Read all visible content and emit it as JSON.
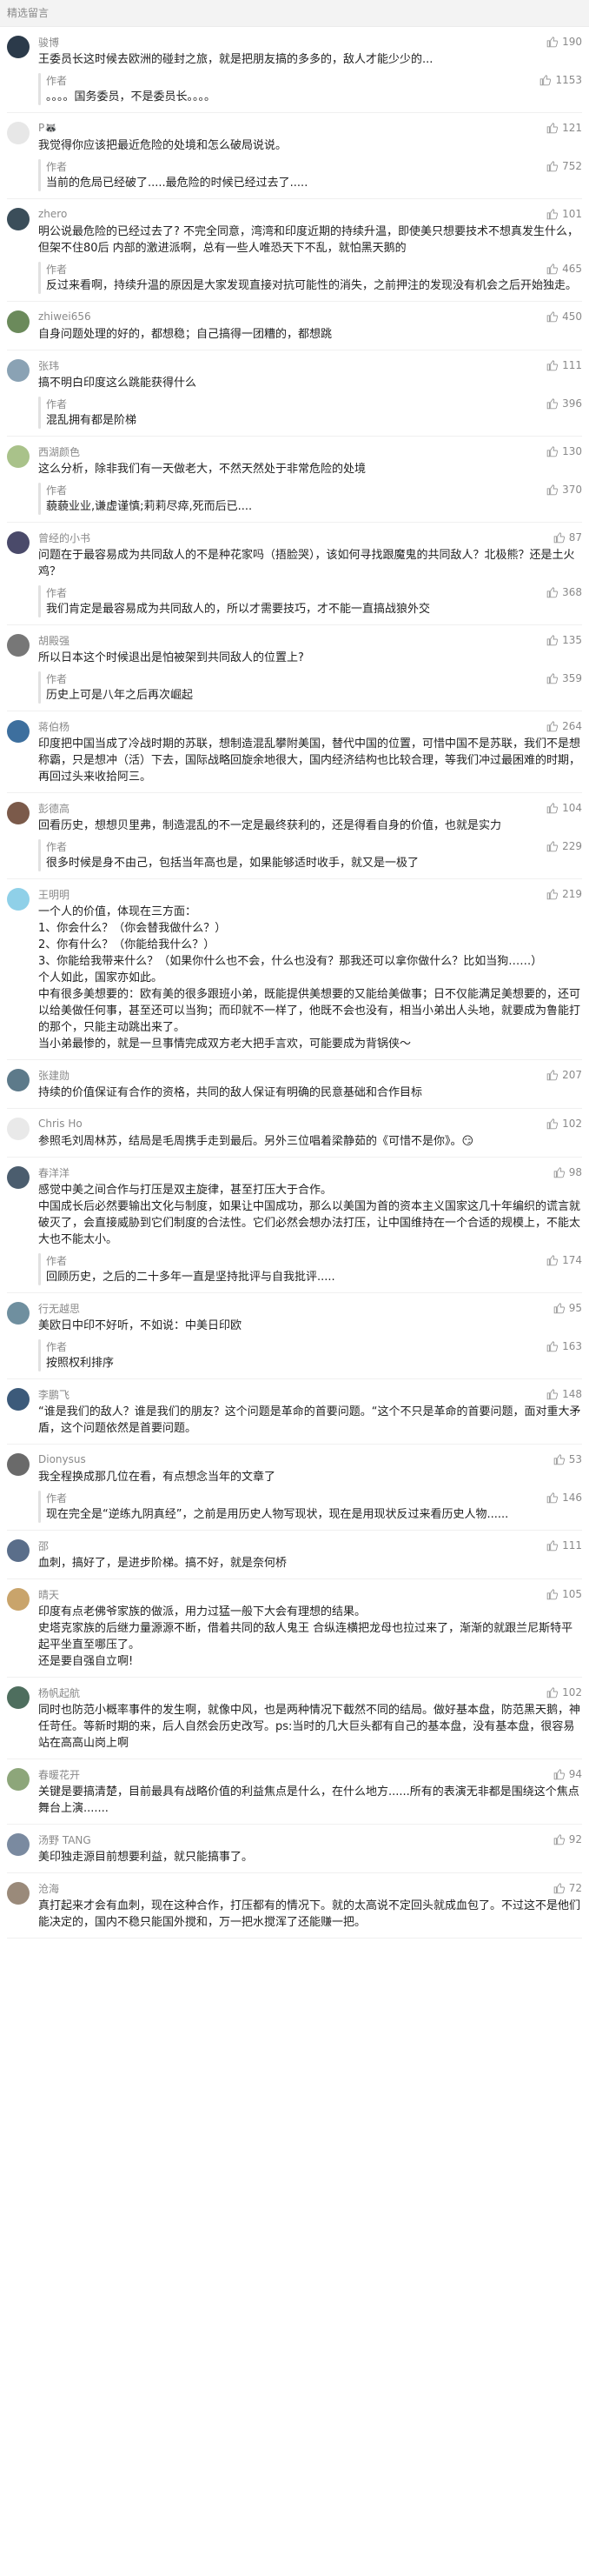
{
  "header": {
    "title": "精选留言"
  },
  "comments": [
    {
      "name": "骏博",
      "likes": "190",
      "avatar_color": "#2b3a4a",
      "text": "王委员长这时候去欧洲的碰封之旅，就是把朋友搞的多多的，敌人才能少少的...",
      "reply_name": "作者",
      "reply_likes": "1153",
      "reply_text": "。。。。国务委员，不是委员长。。。。"
    },
    {
      "name": "P🦝",
      "likes": "121",
      "avatar_color": "#e7e7e7",
      "text": "我觉得你应该把最近危险的处境和怎么破局说说。",
      "reply_name": "作者",
      "reply_likes": "752",
      "reply_text": "当前的危局已经破了.....最危险的时候已经过去了....."
    },
    {
      "name": "zhero",
      "likes": "101",
      "avatar_color": "#3b4e5a",
      "text": "明公说最危险的已经过去了? 不完全同意，湾湾和印度近期的持续升温，即使美只想要技术不想真发生什么，但架不住80后 内部的激进派啊，总有一些人唯恐天下不乱，就怕黑天鹅的",
      "reply_name": "作者",
      "reply_likes": "465",
      "reply_text": "反过来看啊，持续升温的原因是大家发现直接对抗可能性的消失，之前押注的发现没有机会之后开始独走。"
    },
    {
      "name": "zhiwei656",
      "likes": "450",
      "avatar_color": "#6b8a5b",
      "text": "自身问题处理的好的，都想稳；自己搞得一团糟的，都想跳",
      "reply_name": "",
      "reply_likes": "",
      "reply_text": ""
    },
    {
      "name": "张玮",
      "likes": "111",
      "avatar_color": "#8aa2b4",
      "text": "搞不明白印度这么跳能获得什么",
      "reply_name": "作者",
      "reply_likes": "396",
      "reply_text": "混乱拥有都是阶梯"
    },
    {
      "name": "西湖颜色",
      "likes": "130",
      "avatar_color": "#a9c28a",
      "text": "这么分析，除非我们有一天做老大，不然天然处于非常危险的处境",
      "reply_name": "作者",
      "reply_likes": "370",
      "reply_text": "藐藐业业,谦虚谨慎;莉莉尽瘁,死而后已...."
    },
    {
      "name": "曾经的小书",
      "likes": "87",
      "avatar_color": "#4a4a6a",
      "text": "问题在于最容易成为共同敌人的不是种花家吗（捂脸哭），该如何寻找跟魔鬼的共同敌人？北极熊？还是土火鸡？",
      "reply_name": "作者",
      "reply_likes": "368",
      "reply_text": "我们肯定是最容易成为共同敌人的，所以才需要技巧，才不能一直搞战狼外交"
    },
    {
      "name": "胡殿强",
      "likes": "135",
      "avatar_color": "#777777",
      "text": "所以日本这个时候退出是怕被架到共同敌人的位置上?",
      "reply_name": "作者",
      "reply_likes": "359",
      "reply_text": "历史上可是八年之后再次崛起"
    },
    {
      "name": "蒋伯杨",
      "likes": "264",
      "avatar_color": "#3d6f9e",
      "text": "印度把中国当成了冷战时期的苏联，想制造混乱攀附美国，替代中国的位置，可惜中国不是苏联，我们不是想称霸，只是想冲（活）下去，国际战略回旋余地很大，国内经济结构也比较合理，等我们冲过最困难的时期，再回过头来收拾阿三。",
      "reply_name": "",
      "reply_likes": "",
      "reply_text": ""
    },
    {
      "name": "彭德高",
      "likes": "104",
      "avatar_color": "#7b5a4a",
      "text": "回看历史，想想贝里弗，制造混乱的不一定是最终获利的，还是得看自身的价值，也就是实力",
      "reply_name": "作者",
      "reply_likes": "229",
      "reply_text": "很多时候是身不由己，包括当年高也是，如果能够适时收手，就又是一极了"
    },
    {
      "name": "王明明",
      "likes": "219",
      "avatar_color": "#8fd0e8",
      "text": "一个人的价值，体现在三方面：\n1、你会什么？（你会替我做什么？）\n2、你有什么？（你能给我什么？）\n3、你能给我带来什么？（如果你什么也不会，什么也没有？那我还可以拿你做什么？比如当狗……）\n个人如此，国家亦如此。\n中有很多美想要的：欧有美的很多跟班小弟，既能提供美想要的又能给美做事；日不仅能满足美想要的，还可以给美做任何事，甚至还可以当狗；而印就不一样了，他既不会也没有，相当小弟出人头地，就要成为鲁能打的那个，只能主动跳出来了。\n当小弟最惨的，就是一旦事情完成双方老大把手言欢，可能要成为背锅侠～",
      "reply_name": "",
      "reply_likes": "",
      "reply_text": ""
    },
    {
      "name": "张建勋",
      "likes": "207",
      "avatar_color": "#5d7a8a",
      "text": "持续的价值保证有合作的资格，共同的敌人保证有明确的民意基础和合作目标",
      "reply_name": "",
      "reply_likes": "",
      "reply_text": ""
    },
    {
      "name": "Chris Ho",
      "likes": "102",
      "avatar_color": "#e9e9e9",
      "text": "参照毛刘周林苏，结局是毛周携手走到最后。另外三位唱着梁静茹的《可惜不是你》。😏",
      "reply_name": "",
      "reply_likes": "",
      "reply_text": ""
    },
    {
      "name": "春洋洋",
      "likes": "98",
      "avatar_color": "#4b5d6e",
      "text": "感觉中美之间合作与打压是双主旋律，甚至打压大于合作。\n中国成长后必然要输出文化与制度，如果让中国成功，那么以美国为首的资本主义国家这几十年编织的谎言就破灭了，会直接威胁到它们制度的合法性。它们必然会想办法打压，让中国维持在一个合适的规模上，不能太大也不能太小。",
      "reply_name": "作者",
      "reply_likes": "174",
      "reply_text": "回顾历史，之后的二十多年一直是坚持批评与自我批评....."
    },
    {
      "name": "行无越思",
      "likes": "95",
      "avatar_color": "#6f8f9f",
      "text": "美欧日中印不好听，不如说：中美日印欧",
      "reply_name": "作者",
      "reply_likes": "163",
      "reply_text": "按照权利排序"
    },
    {
      "name": "李鹏飞",
      "likes": "148",
      "avatar_color": "#3c5a7a",
      "text": "“谁是我们的敌人？谁是我们的朋友？这个问题是革命的首要问题。“这个不只是革命的首要问题，面对重大矛盾，这个问题依然是首要问题。",
      "reply_name": "",
      "reply_likes": "",
      "reply_text": ""
    },
    {
      "name": "Dionysus",
      "likes": "53",
      "avatar_color": "#6a6a6a",
      "text": "我全程换成那几位在看，有点想念当年的文章了",
      "reply_name": "作者",
      "reply_likes": "146",
      "reply_text": "现在完全是“逆练九阴真经”，之前是用历史人物写现状，现在是用现状反过来看历史人物......"
    },
    {
      "name": "邵",
      "likes": "111",
      "avatar_color": "#5a6e8a",
      "text": "血刺，搞好了，是进步阶梯。搞不好，就是奈何桥",
      "reply_name": "",
      "reply_likes": "",
      "reply_text": ""
    },
    {
      "name": "晴天",
      "likes": "105",
      "avatar_color": "#c9a46b",
      "text": "印度有点老佛爷家族的做派，用力过猛一般下大会有理想的结果。\n史塔克家族的后继力量源源不断，借着共同的敌人鬼王 合纵连横把龙母也拉过来了，渐渐的就跟兰尼斯特平起平坐直至哪压了。\n还是要自强自立啊!",
      "reply_name": "",
      "reply_likes": "",
      "reply_text": ""
    },
    {
      "name": "杨帆起航",
      "likes": "102",
      "avatar_color": "#4e6e5e",
      "text": "同时也防范小概率事件的发生啊，就像中风，也是两种情况下截然不同的结局。做好基本盘，防范黑天鹅，神任苛任。等新时期的来，后人自然会历史改写。ps:当时的几大巨头都有自己的基本盘，没有基本盘，很容易站在高高山岗上啊",
      "reply_name": "",
      "reply_likes": "",
      "reply_text": ""
    },
    {
      "name": "春暖花开",
      "likes": "94",
      "avatar_color": "#8da67a",
      "text": "关键是要搞清楚，目前最具有战略价值的利益焦点是什么，在什么地方......所有的表演无非都是围绕这个焦点舞台上演.......",
      "reply_name": "",
      "reply_likes": "",
      "reply_text": ""
    },
    {
      "name": "汤野 TANG",
      "likes": "92",
      "avatar_color": "#7a8aa0",
      "text": "美印独走源目前想要利益，就只能搞事了。",
      "reply_name": "",
      "reply_likes": "",
      "reply_text": ""
    },
    {
      "name": "沧海",
      "likes": "72",
      "avatar_color": "#9a8a7a",
      "text": "真打起来才会有血刺，现在这种合作，打压都有的情况下。就的太高说不定回头就成血包了。不过这不是他们能决定的，国内不稳只能国外搅和，万一把水搅浑了还能赚一把。",
      "reply_name": "",
      "reply_likes": "",
      "reply_text": ""
    }
  ]
}
